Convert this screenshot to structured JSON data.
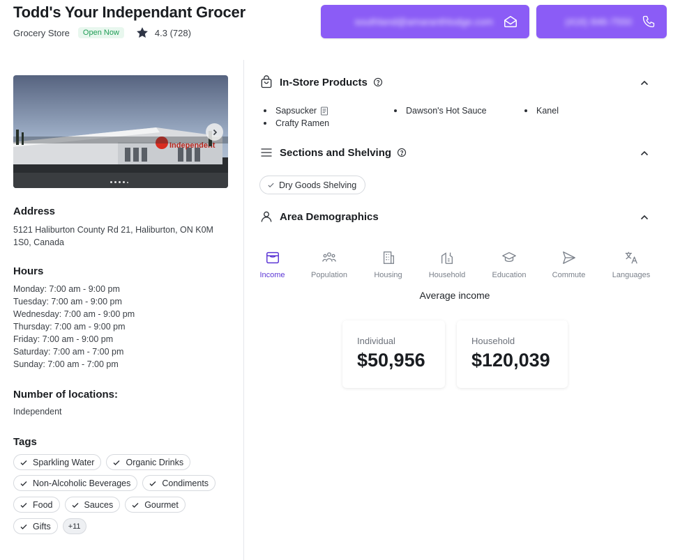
{
  "header": {
    "title": "Todd's Your Independant Grocer",
    "category": "Grocery Store",
    "status": "Open Now",
    "rating": "4.3 (728)",
    "email_label": "southland@amaranthlodge.com",
    "phone_label": "(416) 846-7550",
    "brand_color": "#8b5cf6"
  },
  "photo": {
    "sign_text": "Independent",
    "next_icon": "chevron-right-icon"
  },
  "address": {
    "heading": "Address",
    "line1": "5121 Haliburton County Rd 21, Haliburton, ON K0M",
    "line2": "1S0, Canada"
  },
  "hours": {
    "heading": "Hours",
    "days": [
      "Monday: 7:00 am  -  9:00 pm",
      "Tuesday: 7:00 am  -  9:00 pm",
      "Wednesday: 7:00 am  -  9:00 pm",
      "Thursday: 7:00 am  -  9:00 pm",
      "Friday: 7:00 am  -  9:00 pm",
      "Saturday: 7:00 am  -  7:00 pm",
      "Sunday: 7:00 am  -  7:00 pm"
    ]
  },
  "locations": {
    "heading": "Number of locations:",
    "value": "Independent"
  },
  "tags": {
    "heading": "Tags",
    "items": [
      "Sparkling Water",
      "Organic Drinks",
      "Non-Alcoholic Beverages",
      "Condiments",
      "Food",
      "Sauces",
      "Gourmet",
      "Gifts"
    ],
    "more": "+11"
  },
  "products": {
    "heading": "In-Store Products",
    "items": [
      "Sapsucker",
      "Dawson's Hot Sauce",
      "Kanel",
      "Crafty Ramen"
    ]
  },
  "sections": {
    "heading": "Sections and Shelving",
    "items": [
      "Dry Goods Shelving"
    ]
  },
  "demographics": {
    "heading": "Area Demographics",
    "tabs": [
      "Income",
      "Population",
      "Housing",
      "Household",
      "Education",
      "Commute",
      "Languages"
    ],
    "active_tab": "Income",
    "subtitle": "Average income",
    "cards": [
      {
        "label": "Individual",
        "value": "$50,956"
      },
      {
        "label": "Household",
        "value": "$120,039"
      }
    ]
  }
}
